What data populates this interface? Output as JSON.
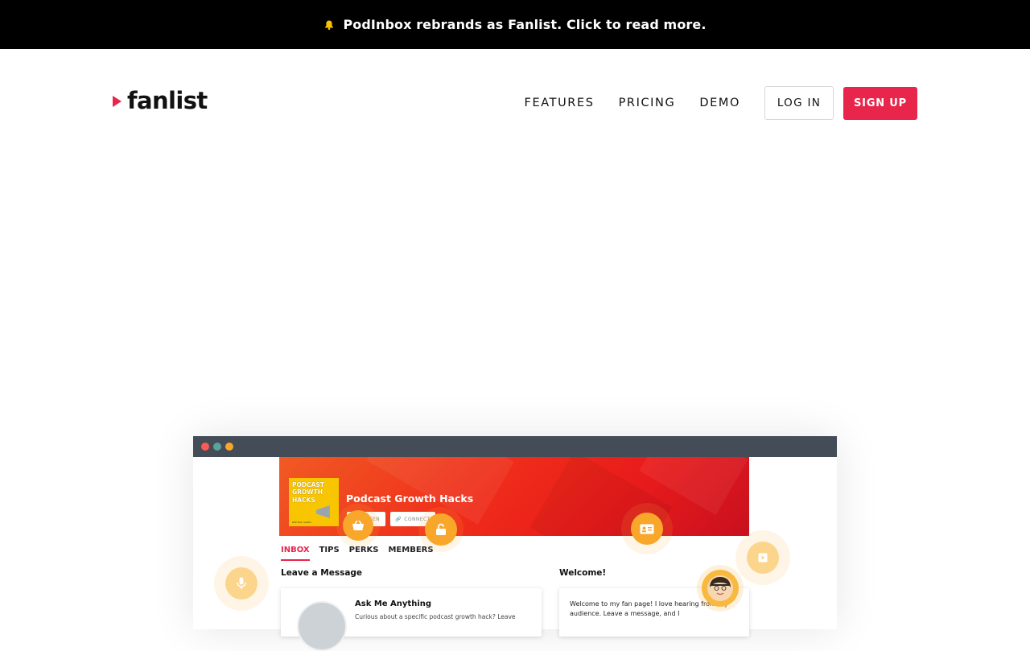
{
  "announcement": {
    "text": "PodInbox rebrands as Fanlist. Click to read more.",
    "icon": "bell-icon"
  },
  "header": {
    "logo_text": "fanlist",
    "nav": [
      "FEATURES",
      "PRICING",
      "DEMO"
    ],
    "login_label": "LOG IN",
    "signup_label": "SIGN UP"
  },
  "colors": {
    "brand": "#e8254a",
    "announce_bg": "#000000",
    "accent_orange": "#f9a72b"
  },
  "preview": {
    "podcast_title": "Podcast Growth Hacks",
    "cover_text": "PODCAST GROWTH HACKS",
    "cover_subtext": "with the creator",
    "listen_label": "LISTEN",
    "connect_label": "CONNECT",
    "tabs": [
      "INBOX",
      "TIPS",
      "PERKS",
      "MEMBERS"
    ],
    "active_tab": "INBOX",
    "leave_message_heading": "Leave a Message",
    "welcome_heading": "Welcome!",
    "ama_title": "Ask Me Anything",
    "ama_desc": "Curious about a specific podcast growth hack? Leave",
    "welcome_text": "Welcome to my fan page! I love hearing from my audience. Leave a message, and I"
  },
  "floating_icons": [
    "basket-icon",
    "unlock-icon",
    "id-card-icon",
    "play-icon",
    "microphone-icon",
    "avatar"
  ]
}
